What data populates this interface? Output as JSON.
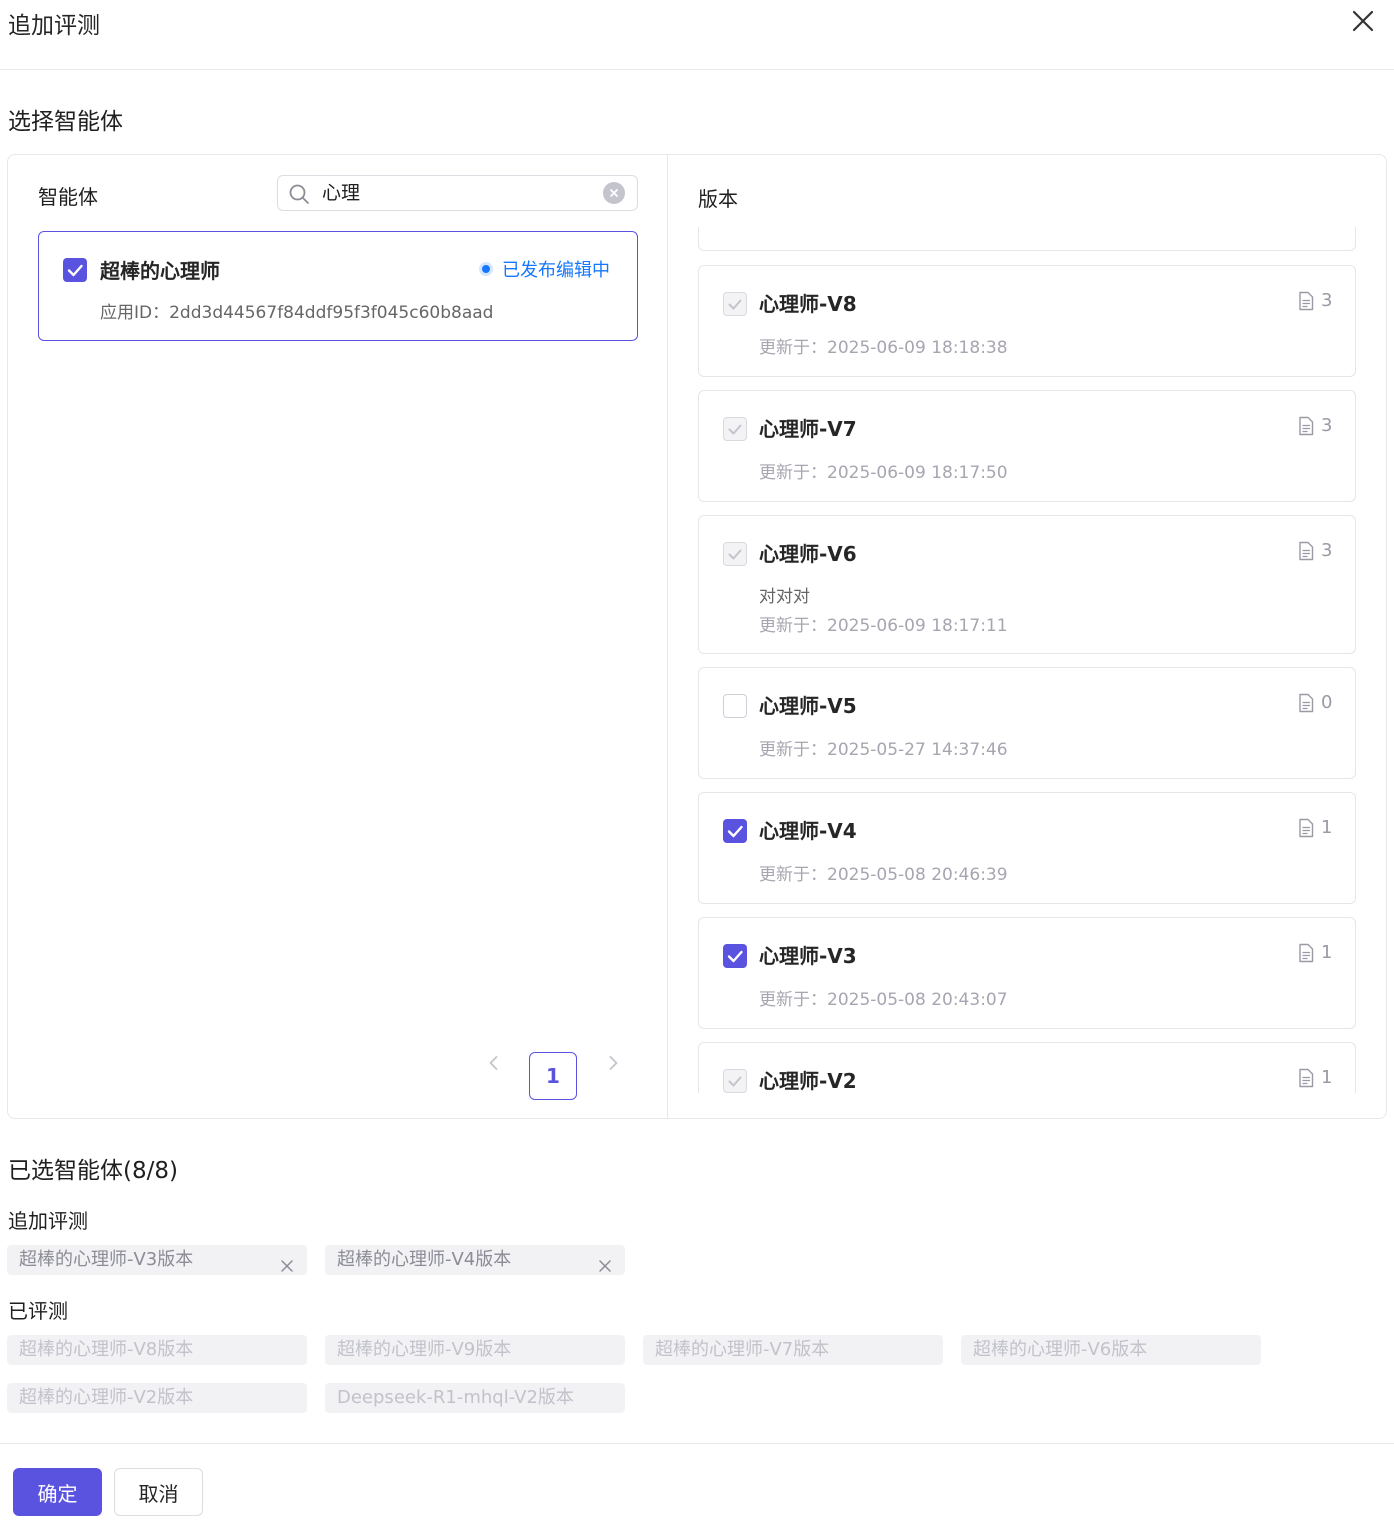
{
  "dialog": {
    "title": "追加评测",
    "close_icon": "close-icon"
  },
  "select_section": {
    "title": "选择智能体"
  },
  "agent_panel": {
    "heading": "智能体",
    "search": {
      "value": "心理",
      "placeholder": ""
    },
    "agent": {
      "name": "超棒的心理师",
      "status": "已发布编辑中",
      "app_id": "应用ID：2dd3d44567f84ddf95f3f045c60b8aad",
      "checked": true
    },
    "pagination": {
      "current_page": "1"
    }
  },
  "version_panel": {
    "heading": "版本",
    "versions": [
      {
        "name": "心理师-V8",
        "count": "3",
        "note": "",
        "updated": "更新于：2025-06-09 18:18:38",
        "state": "disabled"
      },
      {
        "name": "心理师-V7",
        "count": "3",
        "note": "",
        "updated": "更新于：2025-06-09 18:17:50",
        "state": "disabled"
      },
      {
        "name": "心理师-V6",
        "count": "3",
        "note": "对对对",
        "updated": "更新于：2025-06-09 18:17:11",
        "state": "disabled"
      },
      {
        "name": "心理师-V5",
        "count": "0",
        "note": "",
        "updated": "更新于：2025-05-27 14:37:46",
        "state": "unchecked"
      },
      {
        "name": "心理师-V4",
        "count": "1",
        "note": "",
        "updated": "更新于：2025-05-08 20:46:39",
        "state": "checked"
      },
      {
        "name": "心理师-V3",
        "count": "1",
        "note": "",
        "updated": "更新于：2025-05-08 20:43:07",
        "state": "checked"
      },
      {
        "name": "心理师-V2",
        "count": "1",
        "note": "",
        "updated": "",
        "state": "disabled"
      }
    ]
  },
  "selected": {
    "title": "已选智能体(8/8)",
    "add_label": "追加评测",
    "add_tags": [
      "超棒的心理师-V3版本",
      "超棒的心理师-V4版本"
    ],
    "done_label": "已评测",
    "done_tags": [
      "超棒的心理师-V8版本",
      "超棒的心理师-V9版本",
      "超棒的心理师-V7版本",
      "超棒的心理师-V6版本",
      "超棒的心理师-V2版本",
      "Deepseek-R1-mhql-V2版本"
    ]
  },
  "footer": {
    "ok_label": "确定",
    "cancel_label": "取消"
  },
  "colors": {
    "accent": "#5a53e0",
    "status_blue": "#1677ff"
  }
}
